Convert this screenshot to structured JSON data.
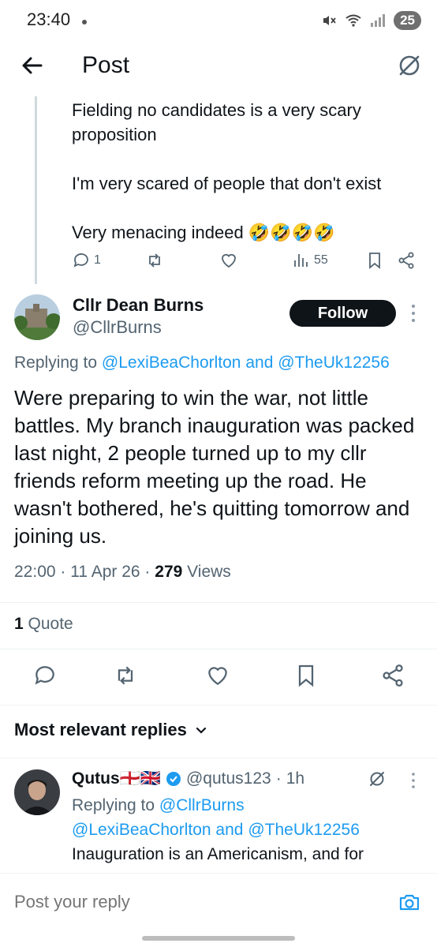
{
  "status_bar": {
    "time": "23:40",
    "battery": "25"
  },
  "header": {
    "title": "Post"
  },
  "parent_tweet": {
    "text": "Fielding no candidates is a very scary proposition\n\nI'm very scared of people that don't exist\n\nVery menacing indeed 🤣🤣🤣🤣",
    "reply_count": "1",
    "views": "55"
  },
  "main_tweet": {
    "author_name": "Cllr Dean Burns",
    "author_handle": "@CllrBurns",
    "follow_label": "Follow",
    "replying_prefix": "Replying to ",
    "mention_1": "@LexiBeaChorlton",
    "and_word": " and ",
    "mention_2": "@TheUk12256",
    "text": "Were preparing to win the war, not little battles. My branch inauguration was packed last night, 2 people turned up to my cllr friends reform meeting up the road. He wasn't bothered, he's quitting tomorrow and joining us.",
    "time": "22:00",
    "date": "11 Apr 26",
    "views_count": "279",
    "views_label": "Views",
    "quote_count": "1",
    "quote_label": "Quote"
  },
  "replies_section": {
    "label": "Most relevant replies"
  },
  "reply_tweet": {
    "author_name": "Qutus🏴󠁧󠁢󠁥󠁮󠁧󠁿🇬🇧",
    "author_handle": "@qutus123",
    "time_ago": "1h",
    "replying_prefix": "Replying to ",
    "mention_1": "@CllrBurns",
    "mention_2": "@LexiBeaChorlton",
    "and_word": " and ",
    "mention_3": "@TheUk12256",
    "text": "Inauguration is an Americanism, and for"
  },
  "compose": {
    "placeholder": "Post your reply"
  },
  "colors": {
    "accent": "#1d9bf0",
    "text": "#0f1419",
    "muted": "#536471"
  }
}
